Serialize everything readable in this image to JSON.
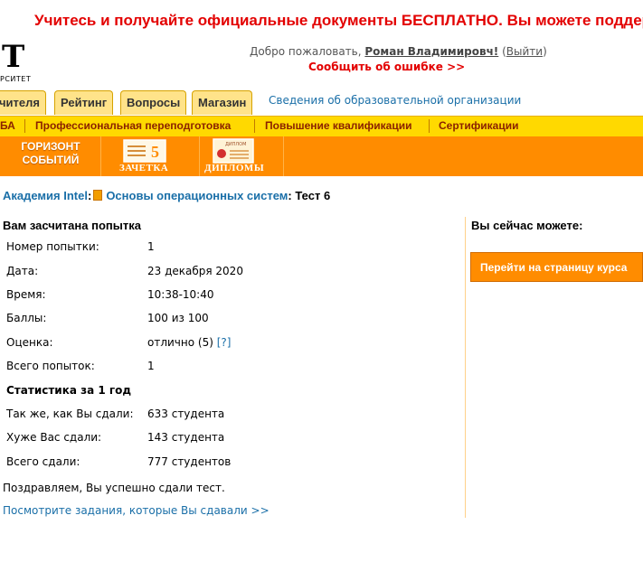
{
  "banner": {
    "text": "Учитесь и получайте официальные документы БЕСПЛАТНО. Вы можете поддержать"
  },
  "logo": {
    "letter": "Т",
    "subtitle": "РСИТЕТ"
  },
  "header": {
    "welcome_prefix": "Добро пожаловать, ",
    "user_name": "Роман Владимировч!",
    "logout_open": " (",
    "logout_label": "Выйти",
    "logout_close": ")",
    "report_error": "Сообщить об ошибке >>"
  },
  "tabs": [
    {
      "label": "чителя"
    },
    {
      "label": "Рейтинг"
    },
    {
      "label": "Вопросы"
    },
    {
      "label": "Магазин"
    }
  ],
  "org_link": "Сведения об образовательной организации",
  "subnav": [
    {
      "label": "БА"
    },
    {
      "label": "Профессиональная переподготовка"
    },
    {
      "label": "Повышение квалификации"
    },
    {
      "label": "Сертификации"
    }
  ],
  "promo": {
    "horizon_line1": "ГОРИЗОНТ",
    "horizon_line2": "СОБЫТИЙ",
    "zachetka_label": "ЗАЧЕТКА",
    "zachetka_badge": "5",
    "diplomas_label": "ДИПЛОМЫ",
    "diploma_badge": "ДИПЛОМ"
  },
  "breadcrumb": {
    "academy": "Академия Intel",
    "colon1": ":",
    "course": "Основы операционных систем",
    "colon2": ":",
    "test": "Тест 6"
  },
  "result": {
    "heading": "Вам засчитана попытка",
    "rows": [
      {
        "label": "Номер попытки:",
        "value": "1"
      },
      {
        "label": "Дата:",
        "value": "23 декабря 2020"
      },
      {
        "label": "Время:",
        "value": "10:38-10:40"
      },
      {
        "label": "Баллы:",
        "value": "100 из 100"
      },
      {
        "label": "Оценка:",
        "value": "отлично (5)",
        "help": "[?]"
      },
      {
        "label": "Всего попыток:",
        "value": "1"
      }
    ],
    "stats_title": "Статистика за 1 год",
    "stats": [
      {
        "label": "Так же, как Вы сдали:",
        "value": "633 студента"
      },
      {
        "label": "Хуже Вас сдали:",
        "value": "143 студента"
      },
      {
        "label": "Всего сдали:",
        "value": "777 студентов"
      }
    ],
    "congrats": "Поздравляем, Вы успешно сдали тест.",
    "review_link": "Посмотрите задания, которые Вы сдавали >>"
  },
  "sidebar": {
    "title": "Вы сейчас можете:",
    "course_button": "Перейти на страницу курса"
  },
  "colors": {
    "banner_red": "#e30000",
    "link_blue": "#1a6fa8",
    "orange": "#ff8c00",
    "yellow": "#ffd900"
  }
}
